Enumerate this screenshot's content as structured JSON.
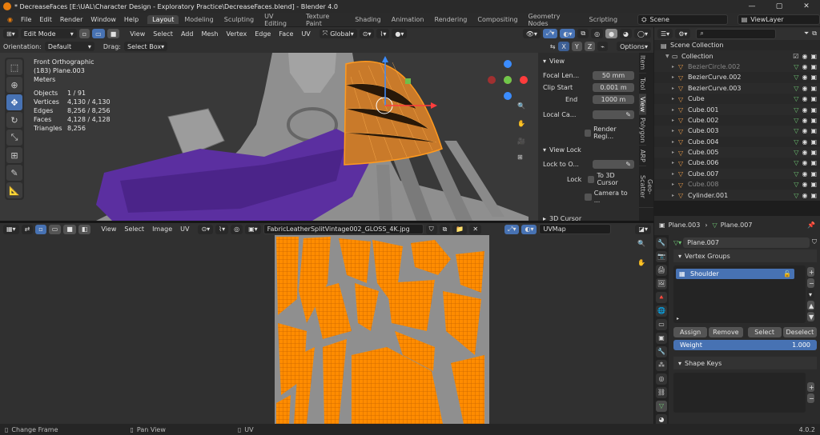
{
  "window": {
    "title": "* DecreaseFaces [E:\\UAL\\Character Design - Exploratory Practice\\DecreaseFaces.blend] - Blender 4.0"
  },
  "menu": [
    "File",
    "Edit",
    "Render",
    "Window",
    "Help"
  ],
  "workspaces": [
    "Layout",
    "Modeling",
    "Sculpting",
    "UV Editing",
    "Texture Paint",
    "Shading",
    "Animation",
    "Rendering",
    "Compositing",
    "Geometry Nodes",
    "Scripting"
  ],
  "scene": {
    "name": "Scene",
    "view_layer": "ViewLayer"
  },
  "viewport": {
    "mode": "Edit Mode",
    "menus": [
      "View",
      "Select",
      "Add",
      "Mesh",
      "Vertex",
      "Edge",
      "Face",
      "UV"
    ],
    "transform": "Global",
    "orientation_label": "Orientation:",
    "orientation": "Default",
    "drag_label": "Drag:",
    "drag": "Select Box",
    "options": "Options",
    "axis": [
      "X",
      "Y",
      "Z"
    ],
    "view_name": "Front Orthographic",
    "object_name": "(183) Plane.003",
    "units": "Meters",
    "stats": [
      {
        "k": "Objects",
        "v": "1 / 91"
      },
      {
        "k": "Vertices",
        "v": "4,130 / 4,130"
      },
      {
        "k": "Edges",
        "v": "8,256 / 8,256"
      },
      {
        "k": "Faces",
        "v": "4,128 / 4,128"
      },
      {
        "k": "Triangles",
        "v": "8,256"
      }
    ]
  },
  "npanel": {
    "view_title": "View",
    "focal_label": "Focal Len...",
    "focal": "50 mm",
    "clip_start_label": "Clip Start",
    "clip_start": "0.001 m",
    "end_label": "End",
    "end": "1000 m",
    "local_cam": "Local Ca...",
    "render_region": "Render Regi...",
    "view_lock_title": "View Lock",
    "lock_to_obj": "Lock to O...",
    "lock": "Lock",
    "to_3d_cursor": "To 3D Cursor",
    "camera_to": "Camera to ...",
    "cursor_title": "3D Cursor",
    "tabs": [
      "Item",
      "Tool",
      "View",
      "Polygon",
      "ARP",
      "Geo-Scatter"
    ]
  },
  "uv_editor": {
    "menus": [
      "View",
      "Select",
      "Image",
      "UV"
    ],
    "image": "FabricLeatherSplitVintage002_GLOSS_4K.jpg",
    "uvmap": "UVMap"
  },
  "outliner": {
    "root": "Scene Collection",
    "collection": "Collection",
    "items": [
      {
        "name": "BezierCircle.002",
        "dim": true
      },
      {
        "name": "BezierCurve.002",
        "dim": false
      },
      {
        "name": "BezierCurve.003",
        "dim": false
      },
      {
        "name": "Cube",
        "dim": false
      },
      {
        "name": "Cube.001",
        "dim": false
      },
      {
        "name": "Cube.002",
        "dim": false
      },
      {
        "name": "Cube.003",
        "dim": false
      },
      {
        "name": "Cube.004",
        "dim": false
      },
      {
        "name": "Cube.005",
        "dim": false
      },
      {
        "name": "Cube.006",
        "dim": false
      },
      {
        "name": "Cube.007",
        "dim": false
      },
      {
        "name": "Cube.008",
        "dim": true
      },
      {
        "name": "Cylinder.001",
        "dim": false
      }
    ]
  },
  "properties": {
    "breadcrumb_obj": "Plane.003",
    "breadcrumb_data": "Plane.007",
    "mesh_name": "Plane.007",
    "vertex_groups_title": "Vertex Groups",
    "vertex_group": "Shoulder",
    "assign": "Assign",
    "remove": "Remove",
    "select": "Select",
    "deselect": "Deselect",
    "weight_label": "Weight",
    "weight": "1.000",
    "shape_keys_title": "Shape Keys"
  },
  "status": {
    "left": "Change Frame",
    "mid": "Pan View",
    "right": "UV",
    "version": "4.0.2"
  }
}
